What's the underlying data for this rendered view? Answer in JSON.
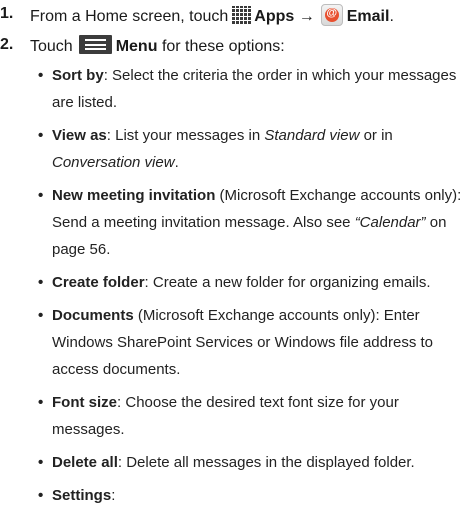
{
  "steps": [
    {
      "num": "1.",
      "text1": "From a Home screen, touch",
      "icon1": "apps-grid-icon",
      "bold1": "Apps",
      "arrow": "→",
      "icon2": "email-app-icon",
      "bold2": "Email",
      "end": "."
    },
    {
      "num": "2.",
      "text1": "Touch",
      "icon1": "menu-key-icon",
      "bold1": "Menu",
      "text2": "for these options:"
    }
  ],
  "options": [
    {
      "name": "Sort by",
      "sep": ": ",
      "desc": "Select the criteria the order in which your messages are listed."
    },
    {
      "name": "View as",
      "sep": ": ",
      "desc": "List your messages in ",
      "it1": "Standard view",
      "mid": " or in ",
      "it2": "Conversation view",
      "end": "."
    },
    {
      "name": "New meeting invitation",
      "sep": " ",
      "desc": "(Microsoft Exchange accounts only): Send a meeting invitation message. Also see ",
      "it1": "“Calendar”",
      "end": " on page 56."
    },
    {
      "name": "Create folder",
      "sep": ": ",
      "desc": "Create a new folder for organizing emails."
    },
    {
      "name": "Documents",
      "sep": " ",
      "desc": "(Microsoft Exchange accounts only): Enter Windows SharePoint Services or Windows file address to access documents."
    },
    {
      "name": "Font size",
      "sep": ": ",
      "desc": "Choose the desired text font size for your messages."
    },
    {
      "name": "Delete all",
      "sep": ": ",
      "desc": "Delete all messages in the displayed folder."
    },
    {
      "name": "Settings",
      "sep": ":",
      "desc": ""
    }
  ]
}
